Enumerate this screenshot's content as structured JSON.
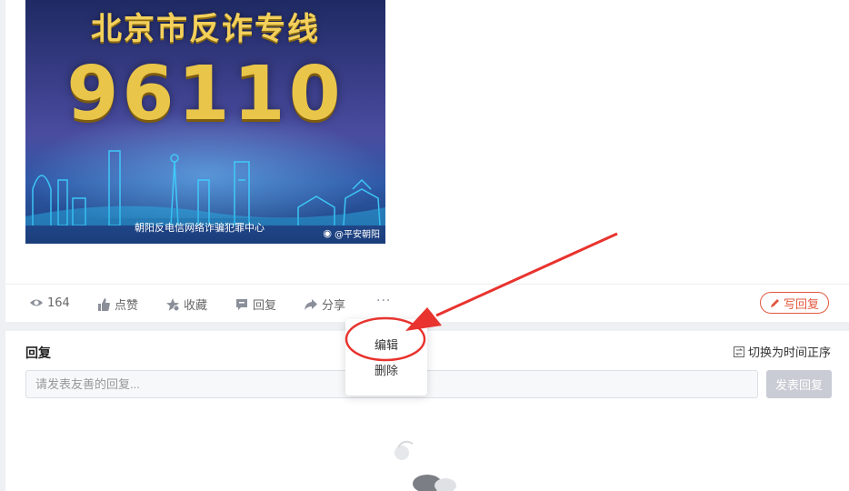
{
  "post": {
    "poster": {
      "title": "北京市反诈专线",
      "number": "96110",
      "org": "朝阳反电信网络诈骗犯罪中心",
      "watermark": "@平安朝阳"
    }
  },
  "actions": {
    "views": "164",
    "like": "点赞",
    "favorite": "收藏",
    "reply": "回复",
    "share": "分享",
    "more": "···",
    "write_reply": "写回复"
  },
  "menu": {
    "items": [
      "编辑",
      "删除"
    ]
  },
  "replies": {
    "title": "回复",
    "sort_toggle": "切换为时间正序",
    "input_placeholder": "请发表友善的回复...",
    "submit": "发表回复"
  },
  "colors": {
    "accent": "#e2583e",
    "annotation": "#e8332e",
    "disabled_button": "#c9ccd4"
  }
}
